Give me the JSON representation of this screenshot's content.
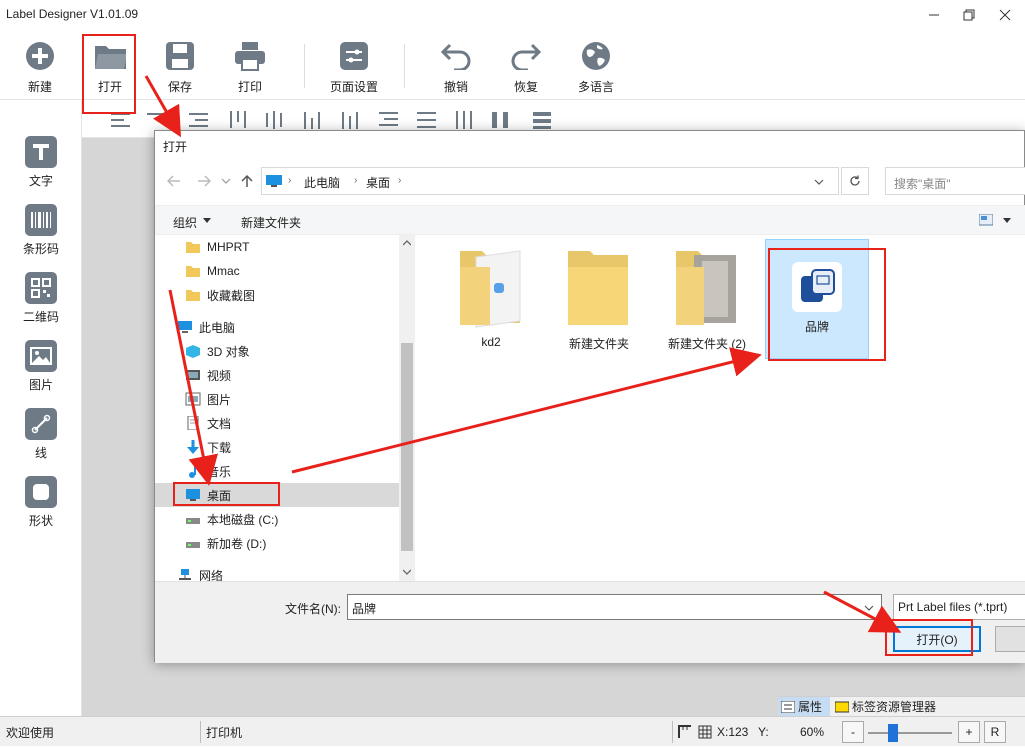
{
  "window": {
    "title": "Label Designer V1.01.09"
  },
  "toolbar": {
    "new": "新建",
    "open": "打开",
    "save": "保存",
    "print": "打印",
    "page_setup": "页面设置",
    "undo": "撤销",
    "redo": "恢复",
    "language": "多语言"
  },
  "sidebar": {
    "text": "文字",
    "barcode": "条形码",
    "qrcode": "二维码",
    "image": "图片",
    "line": "线",
    "shape": "形状"
  },
  "dialog": {
    "title": "打开",
    "breadcrumb": [
      "此电脑",
      "桌面"
    ],
    "search_placeholder": "搜索\"桌面\"",
    "organize": "组织",
    "new_folder": "新建文件夹",
    "nav_items": [
      {
        "label": "MHPRT",
        "icon": "folder-icon"
      },
      {
        "label": "Mmac",
        "icon": "folder-icon"
      },
      {
        "label": "收藏截图",
        "icon": "folder-icon"
      },
      {
        "label": "此电脑",
        "icon": "computer-icon"
      },
      {
        "label": "3D 对象",
        "icon": "cube-icon"
      },
      {
        "label": "视频",
        "icon": "video-icon"
      },
      {
        "label": "图片",
        "icon": "pictures-icon"
      },
      {
        "label": "文档",
        "icon": "document-icon"
      },
      {
        "label": "下载",
        "icon": "download-icon"
      },
      {
        "label": "音乐",
        "icon": "music-icon"
      },
      {
        "label": "桌面",
        "icon": "desktop-icon"
      },
      {
        "label": "本地磁盘 (C:)",
        "icon": "drive-icon"
      },
      {
        "label": "新加卷 (D:)",
        "icon": "drive-icon"
      },
      {
        "label": "网络",
        "icon": "network-icon"
      }
    ],
    "files": [
      {
        "label": "kd2"
      },
      {
        "label": "新建文件夹"
      },
      {
        "label": "新建文件夹 (2)"
      },
      {
        "label": "品牌"
      }
    ],
    "filename_label": "文件名(N):",
    "filename_value": "品牌",
    "filetype": "Prt Label files (*.tprt)",
    "open_button": "打开(O)"
  },
  "panel_tabs": {
    "properties": "属性",
    "resources": "标签资源管理器"
  },
  "statusbar": {
    "welcome": "欢迎使用",
    "printer": "打印机",
    "x": "X:123",
    "y": "Y:",
    "zoom": "60%",
    "minus": "-",
    "plus": "+",
    "reset": "R",
    "zoom_slider_fraction": 0.3
  },
  "colors": {
    "annotation_red": "#e8221a",
    "icon_gray": "#6e7a85",
    "selected_bg": "#cce8ff"
  }
}
